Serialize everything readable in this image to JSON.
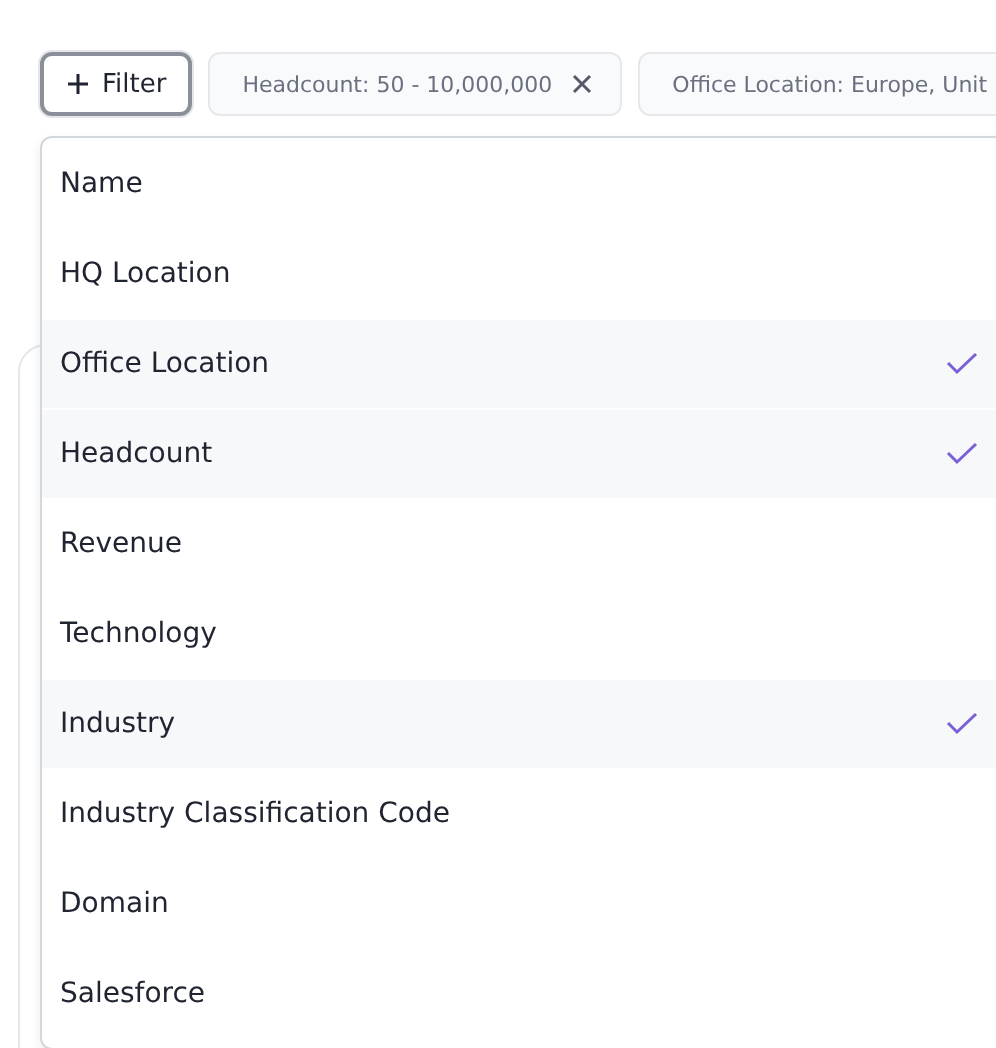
{
  "filter_button": {
    "label": "Filter"
  },
  "chips": [
    {
      "label": "Headcount: 50 - 10,000,000",
      "removable": true
    },
    {
      "label": "Office Location: Europe, Unit",
      "removable": false
    }
  ],
  "menu": {
    "items": [
      {
        "label": "Name",
        "selected": false
      },
      {
        "label": "HQ Location",
        "selected": false
      },
      {
        "label": "Office Location",
        "selected": true
      },
      {
        "label": "Headcount",
        "selected": true
      },
      {
        "label": "Revenue",
        "selected": false
      },
      {
        "label": "Technology",
        "selected": false
      },
      {
        "label": "Industry",
        "selected": true
      },
      {
        "label": "Industry Classification Code",
        "selected": false
      },
      {
        "label": "Domain",
        "selected": false
      },
      {
        "label": "Salesforce",
        "selected": false
      }
    ]
  }
}
